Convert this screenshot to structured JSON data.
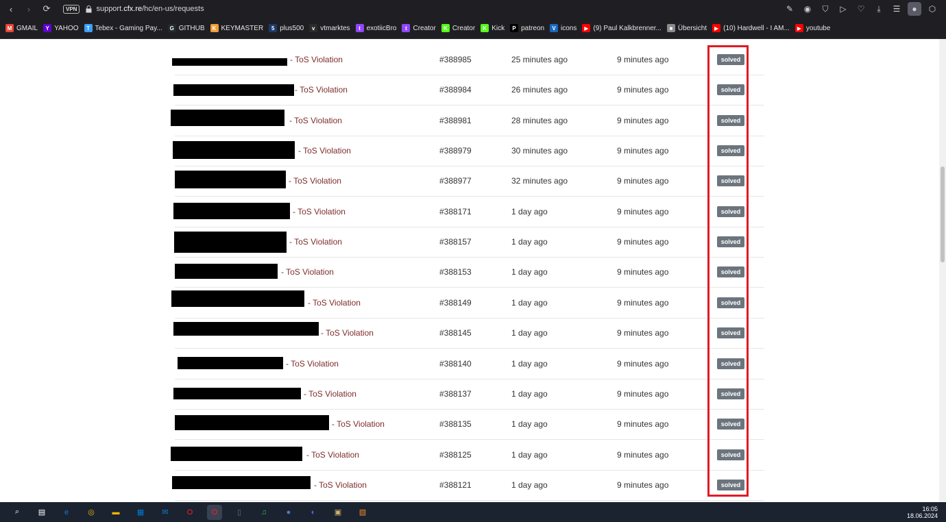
{
  "browser": {
    "url_prefix": "support.",
    "url_domain": "cfx.re",
    "url_path": "/hc/en-us/requests",
    "vpn_label": "VPN"
  },
  "bookmarks": [
    {
      "label": "GMAIL",
      "icon": "gmail-icon",
      "color": "#ea4335",
      "glyph": "M"
    },
    {
      "label": "YAHOO",
      "icon": "yahoo-icon",
      "color": "#6001d2",
      "glyph": "Y"
    },
    {
      "label": "Tebex - Gaming Pay...",
      "icon": "tebex-icon",
      "color": "#3aa0ff",
      "glyph": "T"
    },
    {
      "label": "GITHUB",
      "icon": "github-icon",
      "color": "#24292e",
      "glyph": "G"
    },
    {
      "label": "KEYMASTER",
      "icon": "keymaster-icon",
      "color": "#f29c38",
      "glyph": "K"
    },
    {
      "label": "plus500",
      "icon": "plus500-icon",
      "color": "#1b3a6b",
      "glyph": "5"
    },
    {
      "label": "vtmarktes",
      "icon": "vtmarkets-icon",
      "color": "#2b2b2b",
      "glyph": "v"
    },
    {
      "label": "exotiicBro",
      "icon": "twitch-icon",
      "color": "#9146ff",
      "glyph": "t"
    },
    {
      "label": "Creator",
      "icon": "twitch-icon",
      "color": "#9146ff",
      "glyph": "t"
    },
    {
      "label": "Creator",
      "icon": "kick-icon",
      "color": "#53fc18",
      "glyph": "K"
    },
    {
      "label": "Kick",
      "icon": "kick-icon",
      "color": "#53fc18",
      "glyph": "K"
    },
    {
      "label": "patreon",
      "icon": "patreon-icon",
      "color": "#000000",
      "glyph": "P"
    },
    {
      "label": "icons",
      "icon": "vuetify-icon",
      "color": "#1867c0",
      "glyph": "V"
    },
    {
      "label": "(9) Paul Kalkbrenner...",
      "icon": "youtube-icon",
      "color": "#ff0000",
      "glyph": "▶"
    },
    {
      "label": "Übersicht",
      "icon": "folder-icon",
      "color": "#8a8a8a",
      "glyph": "■"
    },
    {
      "label": "(10) Hardwell - I AM...",
      "icon": "youtube-icon",
      "color": "#ff0000",
      "glyph": "▶"
    },
    {
      "label": "youtube",
      "icon": "youtube-icon",
      "color": "#ff0000",
      "glyph": "▶"
    }
  ],
  "requests": [
    {
      "subject": "- ToS Violation",
      "id": "#388985",
      "created": "25 minutes ago",
      "updated": "9 minutes ago",
      "status": "solved"
    },
    {
      "subject": "- ToS Violation",
      "id": "#388984",
      "created": "26 minutes ago",
      "updated": "9 minutes ago",
      "status": "solved"
    },
    {
      "subject": "- ToS Violation",
      "id": "#388981",
      "created": "28 minutes ago",
      "updated": "9 minutes ago",
      "status": "solved"
    },
    {
      "subject": "- ToS Violation",
      "id": "#388979",
      "created": "30 minutes ago",
      "updated": "9 minutes ago",
      "status": "solved"
    },
    {
      "subject": "- ToS Violation",
      "id": "#388977",
      "created": "32 minutes ago",
      "updated": "9 minutes ago",
      "status": "solved"
    },
    {
      "subject": "- ToS Violation",
      "id": "#388171",
      "created": "1 day ago",
      "updated": "9 minutes ago",
      "status": "solved"
    },
    {
      "subject": "- ToS Violation",
      "id": "#388157",
      "created": "1 day ago",
      "updated": "9 minutes ago",
      "status": "solved"
    },
    {
      "subject": "- ToS Violation",
      "id": "#388153",
      "created": "1 day ago",
      "updated": "9 minutes ago",
      "status": "solved"
    },
    {
      "subject": "- ToS Violation",
      "id": "#388149",
      "created": "1 day ago",
      "updated": "9 minutes ago",
      "status": "solved"
    },
    {
      "subject": "- ToS Violation",
      "id": "#388145",
      "created": "1 day ago",
      "updated": "9 minutes ago",
      "status": "solved"
    },
    {
      "subject": "- ToS Violation",
      "id": "#388140",
      "created": "1 day ago",
      "updated": "9 minutes ago",
      "status": "solved"
    },
    {
      "subject": "- ToS Violation",
      "id": "#388137",
      "created": "1 day ago",
      "updated": "9 minutes ago",
      "status": "solved"
    },
    {
      "subject": "- ToS Violation",
      "id": "#388135",
      "created": "1 day ago",
      "updated": "9 minutes ago",
      "status": "solved"
    },
    {
      "subject": "- ToS Violation",
      "id": "#388125",
      "created": "1 day ago",
      "updated": "9 minutes ago",
      "status": "solved"
    },
    {
      "subject": "- ToS Violation",
      "id": "#388121",
      "created": "1 day ago",
      "updated": "9 minutes ago",
      "status": "solved"
    }
  ],
  "taskbar": {
    "time": "16:05",
    "date": "18.06.2024",
    "apps": [
      "search-icon",
      "task-view-icon",
      "edge-icon",
      "chrome-icon",
      "file-explorer-icon",
      "store-icon",
      "mail-icon",
      "opera-icon",
      "opera-gx-icon",
      "usb-icon",
      "spotify-icon",
      "app-icon",
      "discord-icon",
      "app2-icon",
      "app3-icon"
    ]
  }
}
